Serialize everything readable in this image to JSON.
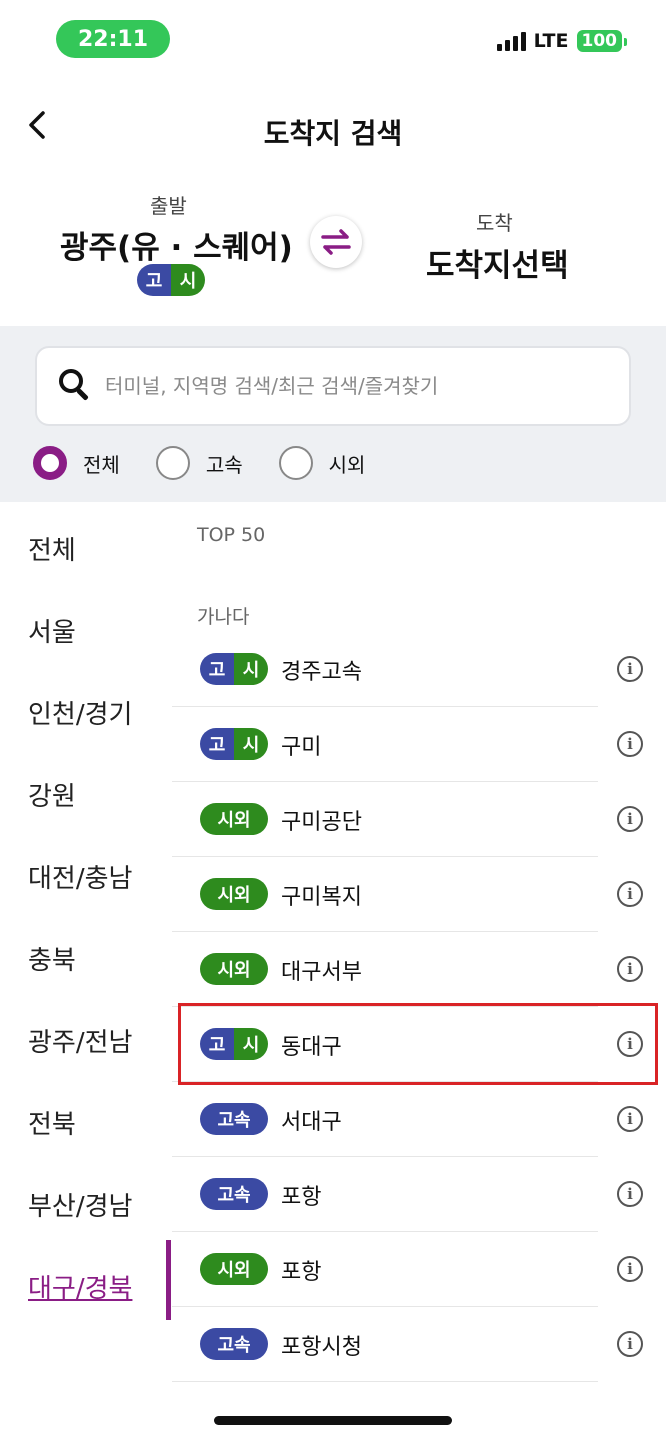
{
  "status": {
    "time": "22:11",
    "network": "LTE",
    "battery": "100"
  },
  "header": {
    "back_icon": "chevron-left-icon",
    "title": "도착지 검색"
  },
  "route": {
    "departure_label": "출발",
    "departure_name": "광주(유 · 스퀘어)",
    "departure_badge": [
      "고",
      "시"
    ],
    "arrival_label": "도착",
    "arrival_name": "도착지선택"
  },
  "search": {
    "placeholder": "터미널, 지역명 검색/최근 검색/즐겨찾기",
    "value": ""
  },
  "filters": [
    {
      "label": "전체",
      "selected": true
    },
    {
      "label": "고속",
      "selected": false
    },
    {
      "label": "시외",
      "selected": false
    }
  ],
  "regions": [
    {
      "label": "전체",
      "selected": false
    },
    {
      "label": "서울",
      "selected": false
    },
    {
      "label": "인천/경기",
      "selected": false
    },
    {
      "label": "강원",
      "selected": false
    },
    {
      "label": "대전/충남",
      "selected": false
    },
    {
      "label": "충북",
      "selected": false
    },
    {
      "label": "광주/전남",
      "selected": false
    },
    {
      "label": "전북",
      "selected": false
    },
    {
      "label": "부산/경남",
      "selected": false
    },
    {
      "label": "대구/경북",
      "selected": true
    }
  ],
  "sections": {
    "top": "TOP 50",
    "alpha": "가나다"
  },
  "badges": {
    "go": "고",
    "si": "시",
    "siwoe": "시외",
    "gosok": "고속"
  },
  "terminals": [
    {
      "name": "경주고속",
      "badge": "dual"
    },
    {
      "name": "구미",
      "badge": "dual"
    },
    {
      "name": "구미공단",
      "badge": "siwoe"
    },
    {
      "name": "구미복지",
      "badge": "siwoe"
    },
    {
      "name": "대구서부",
      "badge": "siwoe"
    },
    {
      "name": "동대구",
      "badge": "dual",
      "highlighted": true
    },
    {
      "name": "서대구",
      "badge": "gosok"
    },
    {
      "name": "포항",
      "badge": "gosok"
    },
    {
      "name": "포항",
      "badge": "siwoe"
    },
    {
      "name": "포항시청",
      "badge": "gosok"
    }
  ],
  "info_icon_glyph": "i",
  "colors": {
    "accent": "#8a1d85",
    "express": "#3b4aa3",
    "intercity": "#2e8b1e",
    "highlight": "#d92326"
  }
}
